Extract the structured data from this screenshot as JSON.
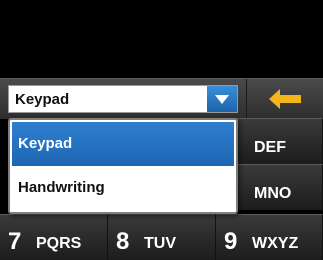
{
  "input_mode": {
    "selected": "Keypad",
    "options": [
      "Keypad",
      "Handwriting"
    ]
  },
  "keys": [
    {
      "num": "",
      "letters": "DEF"
    },
    {
      "num": "",
      "letters": "MNO"
    },
    {
      "num": "7",
      "letters": "PQRS"
    },
    {
      "num": "8",
      "letters": "TUV"
    },
    {
      "num": "9",
      "letters": "WXYZ"
    }
  ],
  "colors": {
    "accent": "#1e66b3",
    "back_arrow": "#f2b51c"
  },
  "icons": {
    "dropdown": "triangle-down-icon",
    "back": "arrow-left-icon"
  }
}
